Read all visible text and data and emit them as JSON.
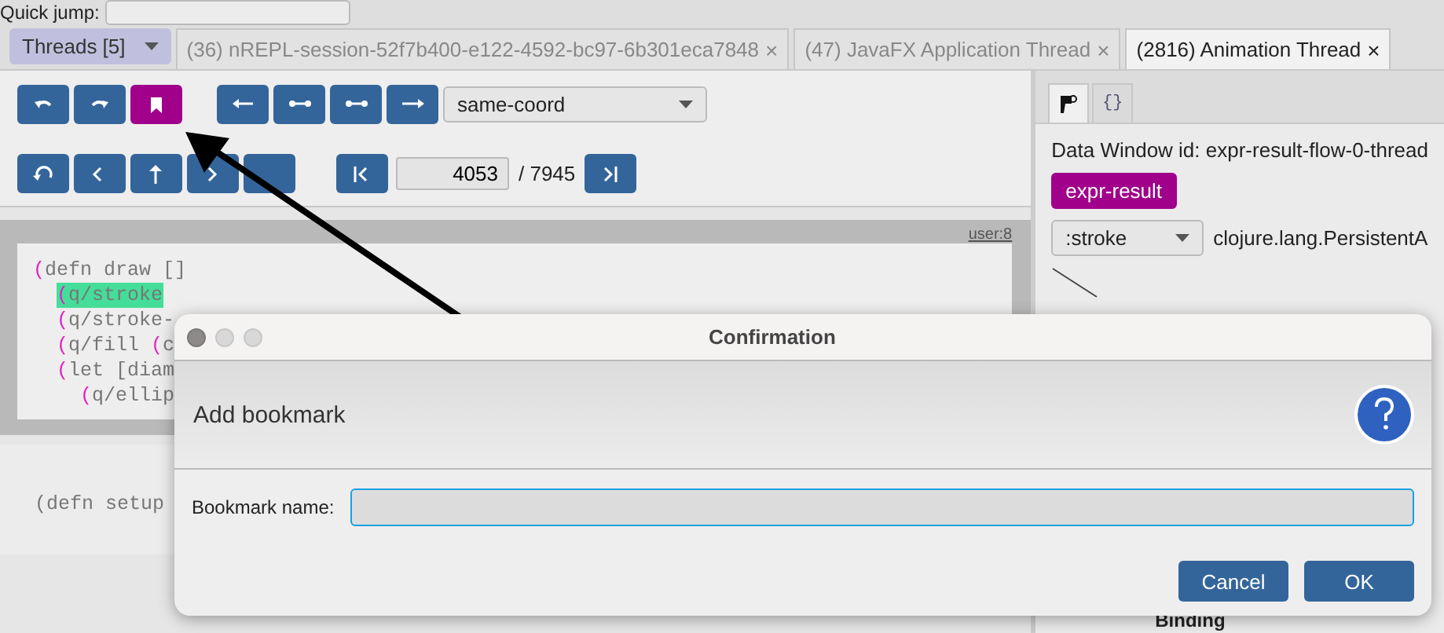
{
  "quick_jump": {
    "label": "Quick jump:"
  },
  "threads_menu": {
    "label": "Threads [5]"
  },
  "tabs": [
    {
      "label": "(36) nREPL-session-52f7b400-e122-4592-bc97-6b301eca7848",
      "close": "×",
      "selected": false
    },
    {
      "label": "(47) JavaFX Application Thread",
      "close": "×",
      "selected": false
    },
    {
      "label": "(2816) Animation Thread",
      "close": "×",
      "selected": true
    }
  ],
  "toolbar": {
    "row_1": [
      {
        "kind": "undo",
        "active": false
      },
      {
        "kind": "redo",
        "active": false
      },
      {
        "kind": "bookmark",
        "active": true
      },
      {
        "kind": "step-first",
        "active": false
      },
      {
        "kind": "step-both",
        "active": false
      },
      {
        "kind": "step-both",
        "active": false
      },
      {
        "kind": "step-last",
        "active": false
      }
    ],
    "mode_select": "same-coord",
    "row_2": [
      {
        "kind": "reset"
      },
      {
        "kind": "prev"
      },
      {
        "kind": "up"
      },
      {
        "kind": "next"
      },
      {
        "kind": "hidden"
      }
    ],
    "first_button": {
      "kind": "first"
    },
    "step_value": "4053",
    "step_total": "/ 7945",
    "last_button": {
      "kind": "last"
    }
  },
  "code": {
    "location": "user:8",
    "lines": [
      {
        "highlighted": false,
        "tokens": [
          {
            "kind": "paren",
            "text": "("
          },
          {
            "kind": "plain",
            "text": "defn draw []"
          }
        ],
        "children": [
          {
            "highlighted": true,
            "tokens": [
              {
                "kind": "paren",
                "text": "("
              },
              {
                "kind": "plain",
                "text": "q/stroke"
              }
            ]
          },
          {
            "highlighted": false,
            "tokens": [
              {
                "kind": "paren",
                "text": "("
              },
              {
                "kind": "plain",
                "text": "q/stroke-"
              }
            ]
          },
          {
            "highlighted": false,
            "tokens": [
              {
                "kind": "paren",
                "text": "("
              },
              {
                "kind": "plain",
                "text": "q/fill "
              },
              {
                "kind": "paren",
                "text": "("
              },
              {
                "kind": "plain",
                "text": "c"
              }
            ]
          },
          {
            "highlighted": false,
            "tokens": [
              {
                "kind": "paren",
                "text": "("
              },
              {
                "kind": "plain",
                "text": "let [diam"
              }
            ],
            "children": [
              {
                "highlighted": false,
                "tokens": [
                  {
                    "kind": "paren",
                    "text": "("
                  },
                  {
                    "kind": "plain",
                    "text": "q/ellip"
                  }
                ]
              }
            ]
          }
        ]
      }
    ],
    "second_block": "(defn setup"
  },
  "data_window": {
    "tabs": [
      {
        "kind": "flag",
        "selected": true
      },
      {
        "kind": "braces",
        "label": "{}",
        "selected": false
      }
    ],
    "id_text": "Data Window id: expr-result-flow-0-thread",
    "tag": "expr-result",
    "key_select": ":stroke",
    "type_text": "clojure.lang.PersistentA",
    "footer": "Binding"
  },
  "dialog": {
    "title": "Confirmation",
    "header": "Add bookmark",
    "field_label": "Bookmark name:",
    "buttons": [
      "Cancel",
      "OK"
    ]
  }
}
